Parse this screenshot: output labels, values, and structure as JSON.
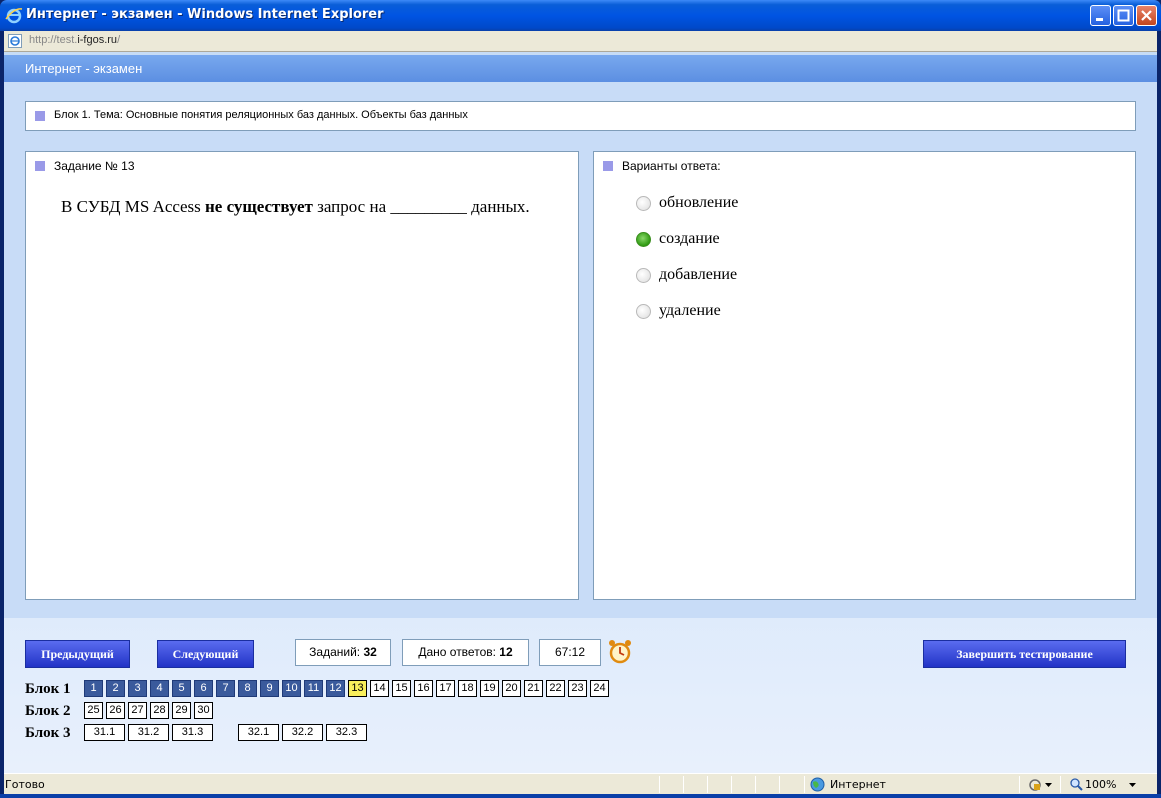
{
  "window": {
    "title": "Интернет - экзамен - Windows Internet Explorer",
    "url_prefix": "http://test.",
    "url_domain": "i-fgos.ru",
    "url_suffix": "/"
  },
  "app": {
    "header": "Интернет - экзамен"
  },
  "block": {
    "title": "Блок 1. Тема: Основные понятия реляционных баз данных. Объекты баз данных"
  },
  "task": {
    "label": "Задание № 13",
    "text_before": "В СУБД MS Access ",
    "text_bold": "не существует",
    "text_after": " запрос на _________ данных."
  },
  "answers": {
    "label": "Варианты ответа:",
    "options": [
      {
        "label": "обновление",
        "selected": false
      },
      {
        "label": "создание",
        "selected": true
      },
      {
        "label": "добавление",
        "selected": false
      },
      {
        "label": "удаление",
        "selected": false
      }
    ]
  },
  "footer": {
    "prev_label": "Предыдущий",
    "next_label": "Следующий",
    "tasks_label": "Заданий:",
    "tasks_count": "32",
    "answered_label": "Дано ответов:",
    "answered_count": "12",
    "timer": "67:12",
    "finish_label": "Завершить тестирование"
  },
  "navigator": {
    "block1_label": "Блок 1",
    "block2_label": "Блок 2",
    "block3_label": "Блок 3",
    "block1": [
      "1",
      "2",
      "3",
      "4",
      "5",
      "6",
      "7",
      "8",
      "9",
      "10",
      "11",
      "12",
      "13",
      "14",
      "15",
      "16",
      "17",
      "18",
      "19",
      "20",
      "21",
      "22",
      "23",
      "24"
    ],
    "block1_answered_count": 12,
    "current": "13",
    "block2": [
      "25",
      "26",
      "27",
      "28",
      "29",
      "30"
    ],
    "block3a": [
      "31.1",
      "31.2",
      "31.3"
    ],
    "block3b": [
      "32.1",
      "32.2",
      "32.3"
    ]
  },
  "statusbar": {
    "status": "Готово",
    "zone": "Интернет",
    "zoom": "100%"
  }
}
